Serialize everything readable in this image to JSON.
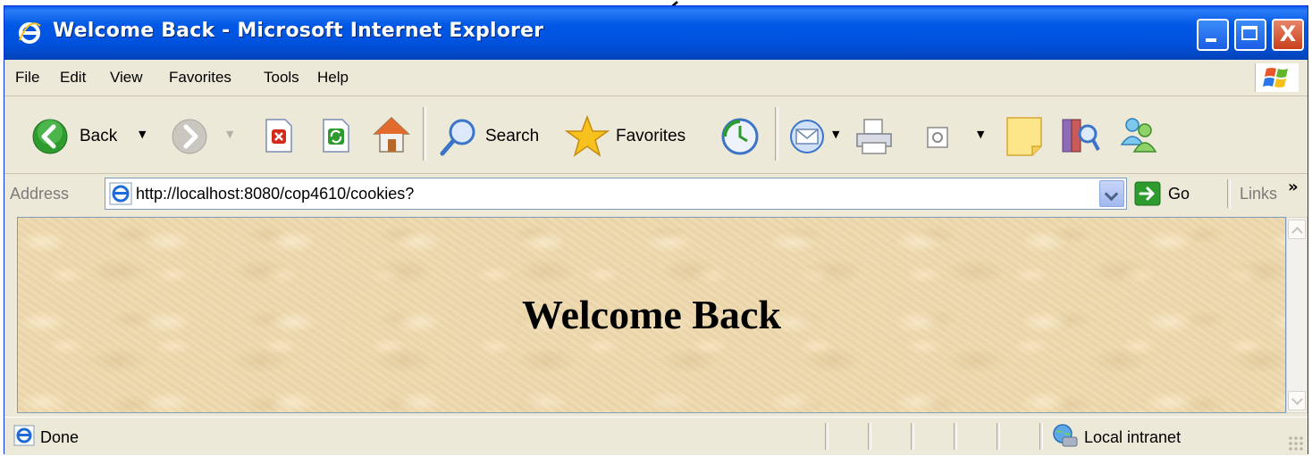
{
  "window": {
    "title": "Welcome Back - Microsoft Internet Explorer",
    "close_glyph": "X"
  },
  "menu": {
    "items": [
      "File",
      "Edit",
      "View",
      "Favorites",
      "Tools",
      "Help"
    ]
  },
  "toolbar": {
    "back_label": "Back",
    "search_label": "Search",
    "favorites_label": "Favorites"
  },
  "address": {
    "label": "Address",
    "url": "http://localhost:8080/cop4610/cookies?",
    "go_label": "Go",
    "links_label": "Links",
    "more_glyph": "»"
  },
  "page": {
    "heading": "Welcome Back",
    "background_color": "#eed9ae"
  },
  "status": {
    "text": "Done",
    "zone": "Local intranet"
  },
  "colors": {
    "titlebar": "#0058e6",
    "chrome": "#ece9d8",
    "back_button": "#2e9b2e",
    "stop_button": "#d42a1a",
    "favorites_star": "#f7c21e"
  },
  "icons": {
    "title": "ie-logo-icon",
    "back": "back-arrow-icon",
    "forward": "forward-arrow-icon",
    "stop": "stop-icon",
    "refresh": "refresh-icon",
    "home": "home-icon",
    "search": "search-icon",
    "favorites": "favorites-star-icon",
    "history": "history-icon",
    "mail": "mail-icon",
    "print": "print-icon",
    "edit": "edit-icon",
    "notes": "notes-icon",
    "research": "research-icon",
    "messenger": "messenger-icon",
    "go": "go-arrow-icon",
    "zone": "local-intranet-icon"
  }
}
